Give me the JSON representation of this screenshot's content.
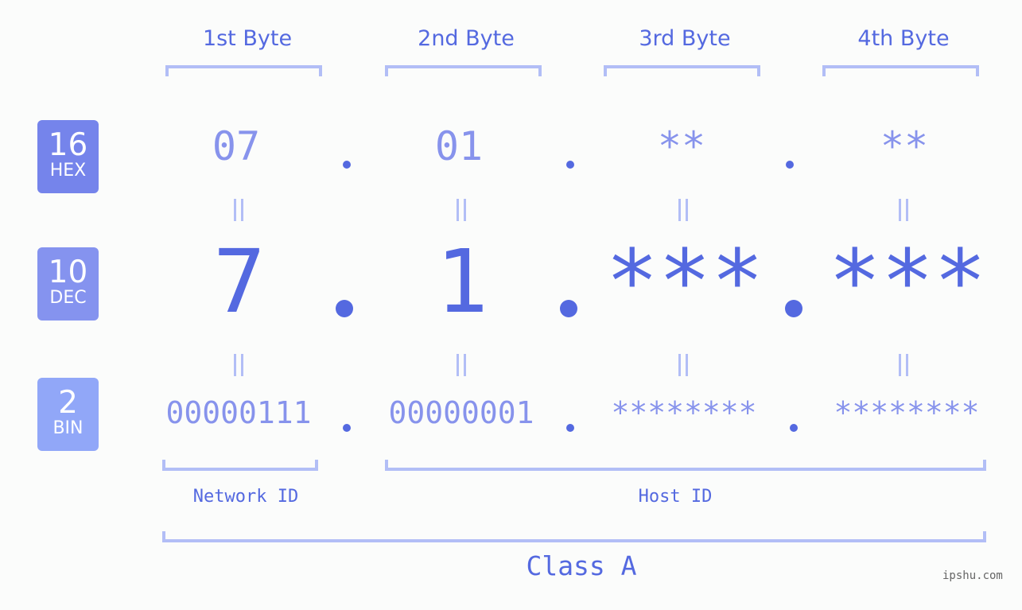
{
  "bytes": [
    {
      "label": "1st Byte",
      "hex": "07",
      "dec": "7",
      "bin": "00000111"
    },
    {
      "label": "2nd Byte",
      "hex": "01",
      "dec": "1",
      "bin": "00000001"
    },
    {
      "label": "3rd Byte",
      "hex": "**",
      "dec": "***",
      "bin": "********"
    },
    {
      "label": "4th Byte",
      "hex": "**",
      "dec": "***",
      "bin": "********"
    }
  ],
  "badges": [
    {
      "num": "16",
      "label": "HEX",
      "color": "#7584eb"
    },
    {
      "num": "10",
      "label": "DEC",
      "color": "#8593ef"
    },
    {
      "num": "2",
      "label": "BIN",
      "color": "#91a7f8"
    }
  ],
  "network_label": "Network ID",
  "host_label": "Host ID",
  "class_label": "Class A",
  "watermark": "ipshu.com",
  "colors": {
    "accent": "#5469e0",
    "light": "#8793ec",
    "bracket": "#b2bef6"
  }
}
